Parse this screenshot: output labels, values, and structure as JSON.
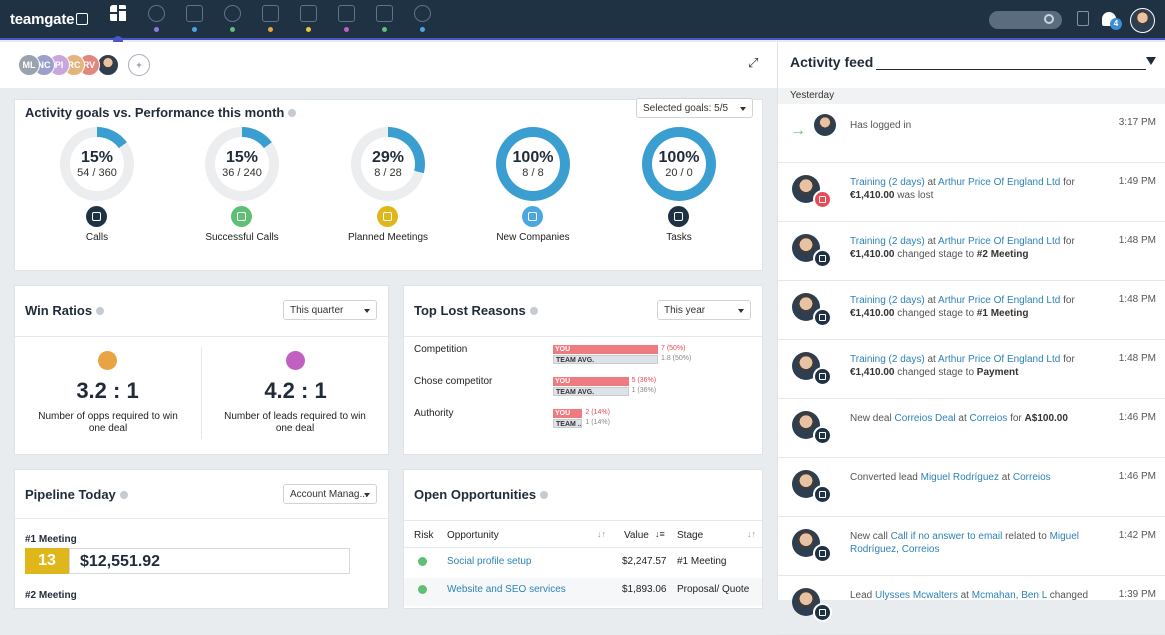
{
  "app": {
    "logo": "teamgate"
  },
  "nav": [
    {
      "icon": "dashboard-icon",
      "dot": ""
    },
    {
      "icon": "target-icon",
      "dot": "#8e7be0"
    },
    {
      "icon": "building-icon",
      "dot": "#4aa7e0"
    },
    {
      "icon": "contacts-icon",
      "dot": "#5fbf74"
    },
    {
      "icon": "briefcase-icon",
      "dot": "#e8a444"
    },
    {
      "icon": "calendar-icon",
      "dot": "#e8c93a"
    },
    {
      "icon": "inbox-icon",
      "dot": "#c060c0"
    },
    {
      "icon": "document-icon",
      "dot": "#5fbf74"
    },
    {
      "icon": "reports-icon",
      "dot": "#4aa7e0"
    }
  ],
  "topbar": {
    "notifications": "4"
  },
  "users": [
    {
      "initials": "ML",
      "color": "#9aa3ad"
    },
    {
      "initials": "NC",
      "color": "#9aa0c9"
    },
    {
      "initials": "PI",
      "color": "#c8a7df"
    },
    {
      "initials": "RC",
      "color": "#e3b57c"
    },
    {
      "initials": "RV",
      "color": "#e0887f"
    }
  ],
  "goals": {
    "title": "Activity goals vs. Performance this month",
    "selector": "Selected goals: 5/5",
    "items": [
      {
        "pct": "15%",
        "sub": "54 / 360",
        "fill": 15,
        "label": "Calls",
        "icon_color": "#1f3244",
        "icon": "phone-icon"
      },
      {
        "pct": "15%",
        "sub": "36 / 240",
        "fill": 15,
        "label": "Successful Calls",
        "icon_color": "#5fbf74",
        "icon": "phone-check-icon"
      },
      {
        "pct": "29%",
        "sub": "8 / 28",
        "fill": 29,
        "label": "Planned Meetings",
        "icon_color": "#e0b71a",
        "icon": "calendar-icon"
      },
      {
        "pct": "100%",
        "sub": "8 / 8",
        "fill": 100,
        "label": "New Companies",
        "icon_color": "#4aa7e0",
        "icon": "building-icon"
      },
      {
        "pct": "100%",
        "sub": "20 / 0",
        "fill": 100,
        "label": "Tasks",
        "icon_color": "#1f3244",
        "icon": "task-icon"
      }
    ]
  },
  "win": {
    "title": "Win Ratios",
    "period": "This quarter",
    "left": {
      "ratio": "3.2 : 1",
      "text": "Number of opps required to win one deal",
      "color": "#e8a444"
    },
    "right": {
      "ratio": "4.2 : 1",
      "text": "Number of leads required to win one deal",
      "color": "#c060c0"
    }
  },
  "lost": {
    "title": "Top Lost Reasons",
    "period": "This year",
    "rows": [
      {
        "reason": "Competition",
        "you_label": "YOU",
        "you": 50,
        "you_note": "7 (50%)",
        "team_label": "TEAM AVG.",
        "team": 50,
        "team_note": "1.8 (50%)"
      },
      {
        "reason": "Chose competitor",
        "you_label": "YOU",
        "you": 36,
        "you_note": "5 (36%)",
        "team_label": "TEAM AVG.",
        "team": 36,
        "team_note": "1 (36%)"
      },
      {
        "reason": "Authority",
        "you_label": "YOU",
        "you": 14,
        "you_note": "2 (14%)",
        "team_label": "TEAM ...",
        "team": 14,
        "team_note": "1 (14%)"
      }
    ]
  },
  "pipeline": {
    "title": "Pipeline Today",
    "selector": "Account Manag...",
    "stage1": "#1 Meeting",
    "count1": "13",
    "amount1": "$12,551.92",
    "stage2": "#2 Meeting"
  },
  "opps": {
    "title": "Open Opportunities",
    "headers": {
      "risk": "Risk",
      "opp": "Opportunity",
      "value": "Value",
      "stage": "Stage"
    },
    "rows": [
      {
        "name": "Social profile setup",
        "value": "$2,247.57",
        "stage": "#1 Meeting"
      },
      {
        "name": "Website and SEO services",
        "value": "$1,893.06",
        "stage": "Proposal/ Quote"
      }
    ]
  },
  "feed": {
    "title": "Activity feed",
    "day": "Yesterday",
    "items": [
      {
        "type": "login",
        "time": "3:17 PM",
        "parts": [
          {
            "t": "Has logged in",
            "c": ""
          }
        ]
      },
      {
        "type": "lost",
        "badge": "#e84b55",
        "time": "1:49 PM",
        "parts": [
          {
            "t": "Training (2 days)",
            "c": "lk"
          },
          {
            "t": " at ",
            "c": ""
          },
          {
            "t": "Arthur Price Of England Ltd",
            "c": "lk"
          },
          {
            "t": " for ",
            "c": ""
          },
          {
            "t": "€1,410.00",
            "c": "bd"
          },
          {
            "t": " was lost",
            "c": ""
          }
        ]
      },
      {
        "type": "stage",
        "badge": "#1f3244",
        "time": "1:48 PM",
        "parts": [
          {
            "t": "Training (2 days)",
            "c": "lk"
          },
          {
            "t": " at ",
            "c": ""
          },
          {
            "t": "Arthur Price Of England Ltd",
            "c": "lk"
          },
          {
            "t": " for ",
            "c": ""
          },
          {
            "t": "€1,410.00",
            "c": "bd"
          },
          {
            "t": " changed stage to ",
            "c": ""
          },
          {
            "t": "#2 Meeting",
            "c": "bd"
          }
        ]
      },
      {
        "type": "stage",
        "badge": "#1f3244",
        "time": "1:48 PM",
        "parts": [
          {
            "t": "Training (2 days)",
            "c": "lk"
          },
          {
            "t": " at ",
            "c": ""
          },
          {
            "t": "Arthur Price Of England Ltd",
            "c": "lk"
          },
          {
            "t": " for ",
            "c": ""
          },
          {
            "t": "€1,410.00",
            "c": "bd"
          },
          {
            "t": " changed stage to ",
            "c": ""
          },
          {
            "t": "#1 Meeting",
            "c": "bd"
          }
        ]
      },
      {
        "type": "stage",
        "badge": "#1f3244",
        "time": "1:48 PM",
        "parts": [
          {
            "t": "Training (2 days)",
            "c": "lk"
          },
          {
            "t": " at ",
            "c": ""
          },
          {
            "t": "Arthur Price Of England Ltd",
            "c": "lk"
          },
          {
            "t": " for ",
            "c": ""
          },
          {
            "t": "€1,410.00",
            "c": "bd"
          },
          {
            "t": " changed stage to ",
            "c": ""
          },
          {
            "t": "Payment",
            "c": "bd"
          }
        ]
      },
      {
        "type": "deal",
        "badge": "#1f3244",
        "time": "1:46 PM",
        "parts": [
          {
            "t": "New deal ",
            "c": ""
          },
          {
            "t": "Correios Deal",
            "c": "lk"
          },
          {
            "t": " at ",
            "c": ""
          },
          {
            "t": "Correios",
            "c": "lk"
          },
          {
            "t": " for ",
            "c": ""
          },
          {
            "t": "A$100.00",
            "c": "bd"
          }
        ]
      },
      {
        "type": "lead",
        "badge": "#1f3244",
        "time": "1:46 PM",
        "parts": [
          {
            "t": "Converted lead ",
            "c": ""
          },
          {
            "t": "Miguel Rodríguez",
            "c": "lk"
          },
          {
            "t": " at ",
            "c": ""
          },
          {
            "t": "Correios",
            "c": "lk"
          }
        ]
      },
      {
        "type": "call",
        "badge": "#1f3244",
        "time": "1:42 PM",
        "parts": [
          {
            "t": "New call ",
            "c": ""
          },
          {
            "t": "Call if no answer to email",
            "c": "lk"
          },
          {
            "t": " related to ",
            "c": ""
          },
          {
            "t": "Miguel Rodríguez",
            "c": "lk"
          },
          {
            "t": ", ",
            "c": ""
          },
          {
            "t": "Correios",
            "c": "lk"
          }
        ]
      },
      {
        "type": "lead",
        "badge": "#1f3244",
        "time": "1:39 PM",
        "parts": [
          {
            "t": "Lead ",
            "c": ""
          },
          {
            "t": "Ulysses Mcwalters",
            "c": "lk"
          },
          {
            "t": " at ",
            "c": ""
          },
          {
            "t": "Mcmahan, Ben L",
            "c": "lk"
          },
          {
            "t": " changed",
            "c": ""
          }
        ]
      }
    ]
  }
}
